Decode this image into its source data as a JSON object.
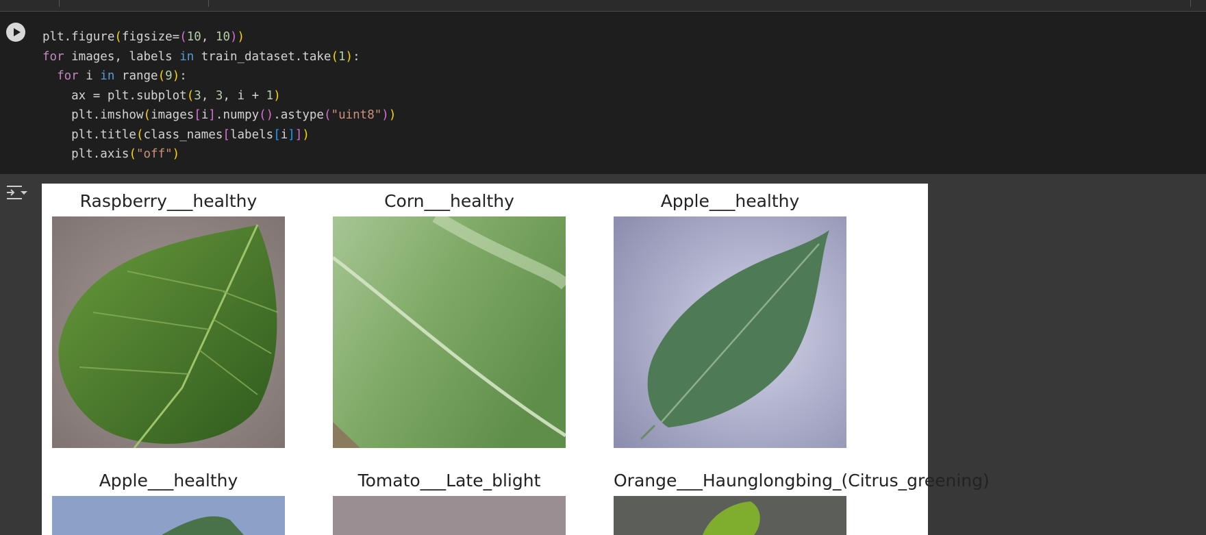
{
  "code_cell": {
    "lines": [
      "plt.figure(figsize=(10, 10))",
      "for images, labels in train_dataset.take(1):",
      "  for i in range(9):",
      "    ax = plt.subplot(3, 3, i + 1)",
      "    plt.imshow(images[i].numpy().astype(\"uint8\"))",
      "    plt.title(class_names[labels[i]])",
      "    plt.axis(\"off\")"
    ]
  },
  "output": {
    "titles": [
      "Raspberry___healthy",
      "Corn___healthy",
      "Apple___healthy",
      "Apple___healthy",
      "Tomato___Late_blight",
      "Orange___Haunglongbing_(Citrus_greening)"
    ]
  },
  "icons": {
    "run": "play-circle-icon",
    "output_toggle": "output-collapse-icon"
  },
  "colors": {
    "editor_bg": "#1e1e1e",
    "page_bg": "#383838",
    "figure_bg": "#ffffff"
  }
}
